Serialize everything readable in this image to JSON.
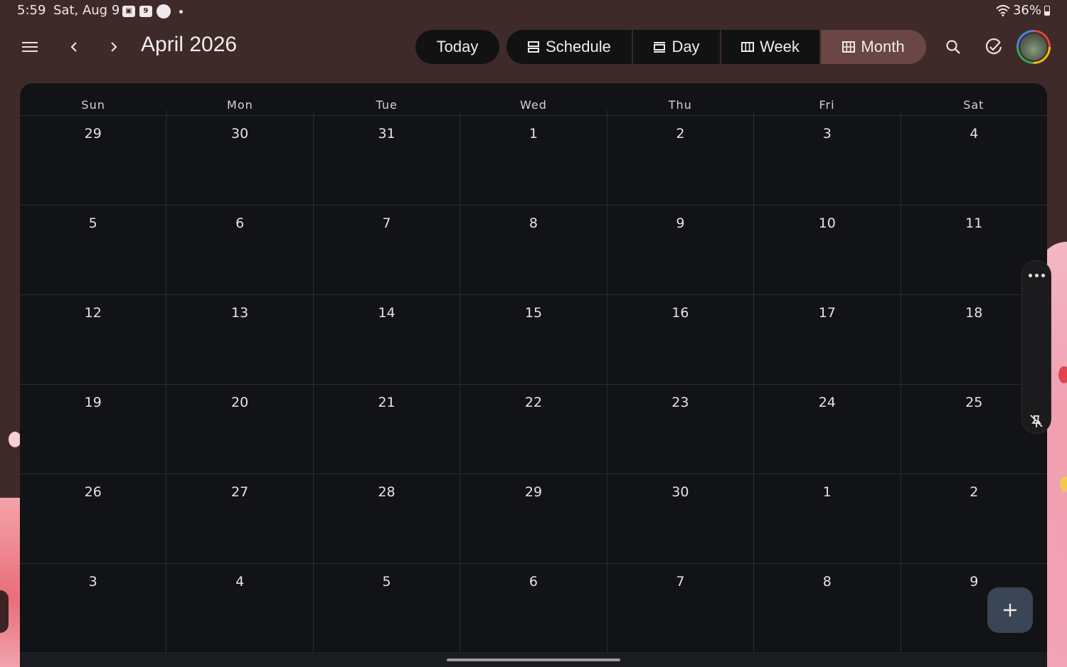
{
  "status_bar": {
    "time": "5:59",
    "date": "Sat, Aug 9",
    "calendar_icon_day": "9",
    "battery": "36%"
  },
  "toolbar": {
    "month_title": "April 2026",
    "today_label": "Today",
    "views": [
      {
        "label": "Schedule",
        "icon": "schedule-view-icon"
      },
      {
        "label": "Day",
        "icon": "day-view-icon"
      },
      {
        "label": "Week",
        "icon": "week-view-icon"
      },
      {
        "label": "Month",
        "icon": "month-view-icon",
        "selected": true
      }
    ]
  },
  "calendar": {
    "weekdays": [
      "Sun",
      "Mon",
      "Tue",
      "Wed",
      "Thu",
      "Fri",
      "Sat"
    ],
    "weeks": [
      [
        "29",
        "30",
        "31",
        "1",
        "2",
        "3",
        "4"
      ],
      [
        "5",
        "6",
        "7",
        "8",
        "9",
        "10",
        "11"
      ],
      [
        "12",
        "13",
        "14",
        "15",
        "16",
        "17",
        "18"
      ],
      [
        "19",
        "20",
        "21",
        "22",
        "23",
        "24",
        "25"
      ],
      [
        "26",
        "27",
        "28",
        "29",
        "30",
        "1",
        "2"
      ],
      [
        "3",
        "4",
        "5",
        "6",
        "7",
        "8",
        "9"
      ]
    ]
  },
  "colors": {
    "background": "#3f2a2a",
    "calendar_bg": "#111317",
    "selected_view": "#6a4644",
    "fab": "#3a4556"
  }
}
